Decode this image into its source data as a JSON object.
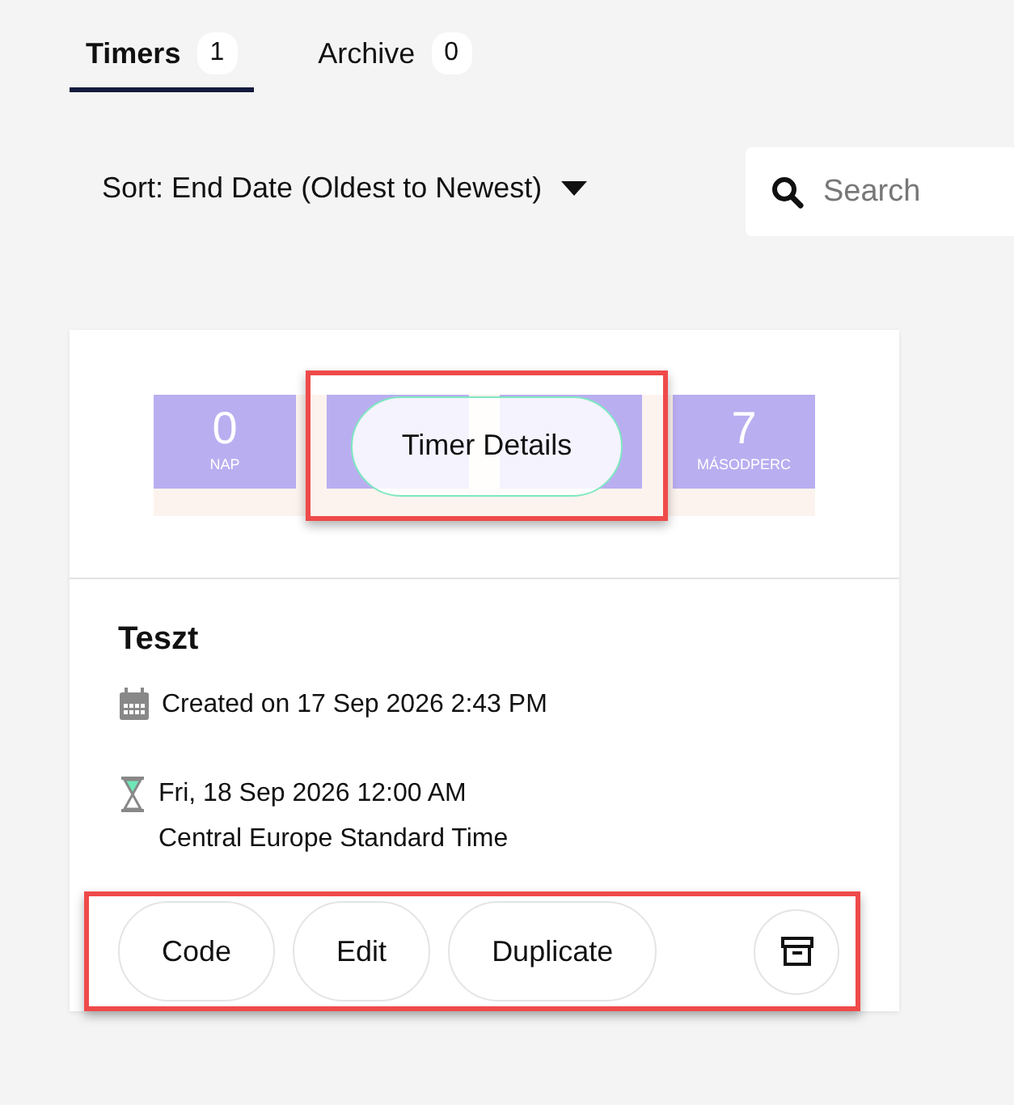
{
  "tabs": [
    {
      "label": "Timers",
      "count": "1",
      "selected": true
    },
    {
      "label": "Archive",
      "count": "0",
      "selected": false
    }
  ],
  "sort": {
    "label": "Sort: End Date (Oldest to Newest)"
  },
  "search": {
    "placeholder": "Search"
  },
  "timer_card": {
    "preview": {
      "units": [
        {
          "kind": "shown",
          "value": "0",
          "label": "NAP"
        },
        {
          "kind": "covered"
        },
        {
          "kind": "covered"
        },
        {
          "kind": "shown",
          "value": "7",
          "label": "MÁSODPERC"
        }
      ],
      "details_button": {
        "label": "Timer Details",
        "highlighted": true
      }
    },
    "title": "Teszt",
    "created": "Created on 17 Sep 2026 2:43 PM",
    "end_date": "Fri, 18 Sep 2026 12:00 AM",
    "timezone": "Central Europe Standard Time",
    "actions": {
      "highlighted": true,
      "buttons": [
        {
          "label": "Code"
        },
        {
          "label": "Edit"
        },
        {
          "label": "Duplicate"
        }
      ]
    }
  }
}
